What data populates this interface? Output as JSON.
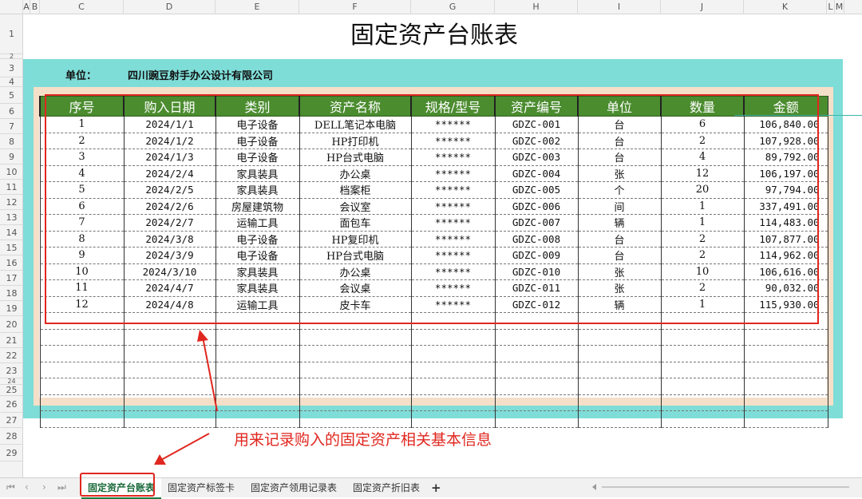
{
  "columns": [
    "A",
    "B",
    "C",
    "D",
    "E",
    "F",
    "G",
    "H",
    "I",
    "J",
    "K",
    "L",
    "M"
  ],
  "rows": [
    "1",
    "2",
    "3",
    "4",
    "5",
    "6",
    "7",
    "8",
    "9",
    "10",
    "11",
    "12",
    "13",
    "14",
    "15",
    "16",
    "17",
    "18",
    "19",
    "20",
    "21",
    "22",
    "23",
    "24",
    "25",
    "26",
    "27",
    "28",
    "29"
  ],
  "sheet": {
    "title": "固定资产台账表",
    "unit_label": "单位：",
    "company": "四川豌豆射手办公设计有限公司"
  },
  "table": {
    "headers": [
      "序号",
      "购入日期",
      "类别",
      "资产名称",
      "规格/型号",
      "资产编号",
      "单位",
      "数量",
      "金额"
    ],
    "rows": [
      [
        "1",
        "2024/1/1",
        "电子设备",
        "DELL笔记本电脑",
        "******",
        "GDZC-001",
        "台",
        "6",
        "106,840.00"
      ],
      [
        "2",
        "2024/1/2",
        "电子设备",
        "HP打印机",
        "******",
        "GDZC-002",
        "台",
        "2",
        "107,928.00"
      ],
      [
        "3",
        "2024/1/3",
        "电子设备",
        "HP台式电脑",
        "******",
        "GDZC-003",
        "台",
        "4",
        "89,792.00"
      ],
      [
        "4",
        "2024/2/4",
        "家具装具",
        "办公桌",
        "******",
        "GDZC-004",
        "张",
        "12",
        "106,197.00"
      ],
      [
        "5",
        "2024/2/5",
        "家具装具",
        "档案柜",
        "******",
        "GDZC-005",
        "个",
        "20",
        "97,794.00"
      ],
      [
        "6",
        "2024/2/6",
        "房屋建筑物",
        "会议室",
        "******",
        "GDZC-006",
        "间",
        "1",
        "337,491.00"
      ],
      [
        "7",
        "2024/2/7",
        "运输工具",
        "面包车",
        "******",
        "GDZC-007",
        "辆",
        "1",
        "114,483.00"
      ],
      [
        "8",
        "2024/3/8",
        "电子设备",
        "HP复印机",
        "******",
        "GDZC-008",
        "台",
        "2",
        "107,877.00"
      ],
      [
        "9",
        "2024/3/9",
        "电子设备",
        "HP台式电脑",
        "******",
        "GDZC-009",
        "台",
        "2",
        "114,962.00"
      ],
      [
        "10",
        "2024/3/10",
        "家具装具",
        "办公桌",
        "******",
        "GDZC-010",
        "张",
        "10",
        "106,616.00"
      ],
      [
        "11",
        "2024/4/7",
        "家具装具",
        "会议桌",
        "******",
        "GDZC-011",
        "张",
        "2",
        "90,032.00"
      ],
      [
        "12",
        "2024/4/8",
        "运输工具",
        "皮卡车",
        "******",
        "GDZC-012",
        "辆",
        "1",
        "115,930.00"
      ]
    ],
    "empty_rows": 7
  },
  "annotation": "用来记录购入的固定资产相关基本信息",
  "tabs": [
    "固定资产台账表",
    "固定资产标签卡",
    "固定资产领用记录表",
    "固定资产折旧表"
  ],
  "tab_nav": {
    "first": "⏮",
    "prev": "‹",
    "next": "›",
    "last": "⏭",
    "add": "+"
  },
  "colors": {
    "band": "#7fddd8",
    "header_green": "#4b8c2f",
    "frame": "#f6dfc8",
    "accent_red": "#e0271f"
  }
}
